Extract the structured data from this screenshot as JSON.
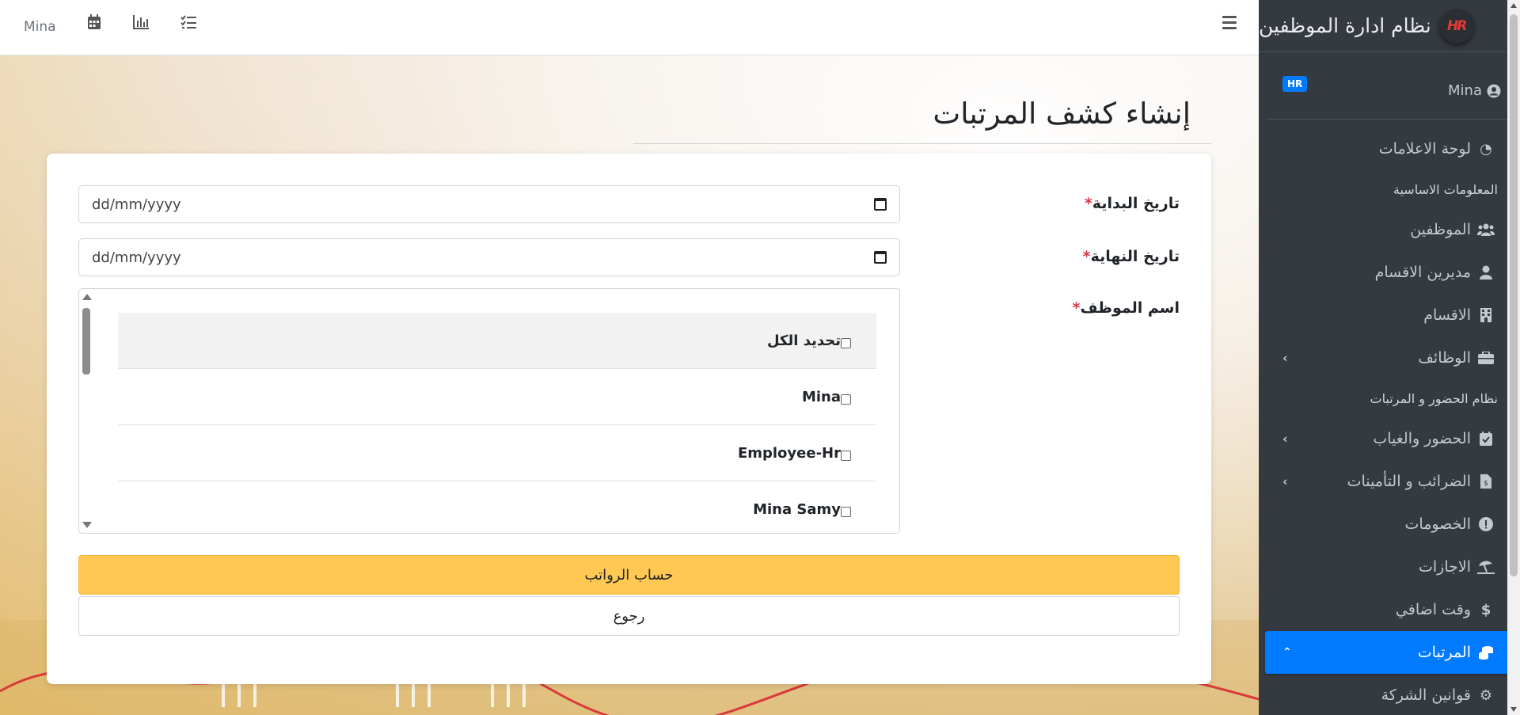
{
  "topnav": {
    "user": "Mina",
    "icons": [
      "calendar-icon",
      "chart-icon",
      "tasks-icon",
      "menu-icon"
    ]
  },
  "sidebar": {
    "brand_logo": "HR",
    "brand_text": "نظام ادارة الموظفين",
    "user_name": "Mina",
    "user_badge": "HR",
    "items": [
      {
        "type": "item",
        "label": "لوحة الاعلامات",
        "icon": "dashboard-icon",
        "chevron": false,
        "active": false
      },
      {
        "type": "header",
        "label": "المعلومات الاساسية"
      },
      {
        "type": "item",
        "label": "الموظفين",
        "icon": "users-icon",
        "chevron": false,
        "active": false
      },
      {
        "type": "item",
        "label": "مديرين الاقسام",
        "icon": "user-icon",
        "chevron": false,
        "active": false
      },
      {
        "type": "item",
        "label": "الاقسام",
        "icon": "building-icon",
        "chevron": false,
        "active": false
      },
      {
        "type": "item",
        "label": "الوظائف",
        "icon": "briefcase-icon",
        "chevron": true,
        "active": false
      },
      {
        "type": "header",
        "label": "نظام الحضور و المرتبات"
      },
      {
        "type": "item",
        "label": "الحضور والغياب",
        "icon": "calendar-check-icon",
        "chevron": true,
        "active": false
      },
      {
        "type": "item",
        "label": "الضرائب و التأمينات",
        "icon": "invoice-icon",
        "chevron": true,
        "active": false
      },
      {
        "type": "item",
        "label": "الخصومات",
        "icon": "exclamation-icon",
        "chevron": false,
        "active": false
      },
      {
        "type": "item",
        "label": "الاجازات",
        "icon": "umbrella-beach-icon",
        "chevron": false,
        "active": false
      },
      {
        "type": "item",
        "label": "وقت اضافي",
        "icon": "dollar-icon",
        "chevron": false,
        "active": false
      },
      {
        "type": "item",
        "label": "المرتبات",
        "icon": "coins-icon",
        "chevron": true,
        "active": true
      },
      {
        "type": "item",
        "label": "قوانين الشركة",
        "icon": "gears-icon",
        "chevron": false,
        "active": false
      }
    ]
  },
  "page": {
    "title": "إنشاء كشف المرتبات",
    "start_date_label": "تاريخ البداية",
    "end_date_label": "تاريخ النهاية",
    "employee_label": "اسم الموظف",
    "required_mark": "*",
    "start_date_placeholder": "dd/mm/yyyy",
    "end_date_placeholder": "dd/mm/yyyy",
    "employees": [
      "تحديد الكل",
      "Mina",
      "Employee-Hr",
      "Mina Samy"
    ],
    "calc_button": "حساب الرواتب",
    "back_button": "رجوع"
  },
  "colors": {
    "sidebar_bg": "#343a40",
    "active_item": "#007bff",
    "calc_button": "#ffc853",
    "required": "#dc3545"
  }
}
